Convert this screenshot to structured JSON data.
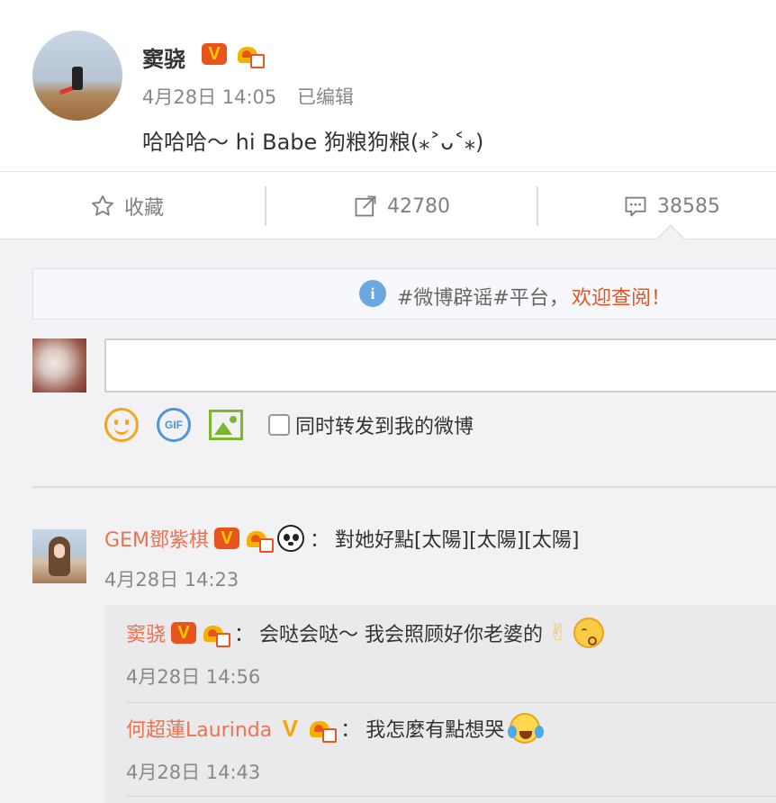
{
  "post": {
    "author": "窦骁",
    "time": "4月28日 14:05",
    "edited": "已编辑",
    "text": "哈哈哈～ hi Babe 狗粮狗粮(⁎˃ᴗ˂⁎)"
  },
  "actions": {
    "favorite": "收藏",
    "repost_count": "42780",
    "comment_count": "38585"
  },
  "notice": {
    "tag": "#微博辟谣#平台，",
    "link": "欢迎查阅！"
  },
  "composer": {
    "sync_label": "同时转发到我的微博"
  },
  "comment": {
    "user": "GEM鄧紫棋",
    "colon": "：",
    "text": "對她好點[太陽][太陽][太陽]",
    "time": "4月28日 14:23"
  },
  "replies": [
    {
      "user": "窦骁",
      "colon": "：",
      "text": "会哒会哒～ 我会照顾好你老婆的",
      "time": "4月28日 14:56"
    },
    {
      "user": "何超蓮Laurinda",
      "colon": "：",
      "text": "我怎麼有點想哭",
      "time": "4月28日 14:43"
    }
  ],
  "colors": {
    "username": "#eb7350",
    "vip_orange": "#e8541e",
    "notice_link": "#e8541e"
  },
  "icons": {
    "favorite": "star-icon",
    "repost": "share-icon",
    "comment": "comment-icon",
    "info": "info-icon",
    "emoji": "smiley-icon",
    "gif": "gif-icon",
    "image": "image-icon"
  }
}
